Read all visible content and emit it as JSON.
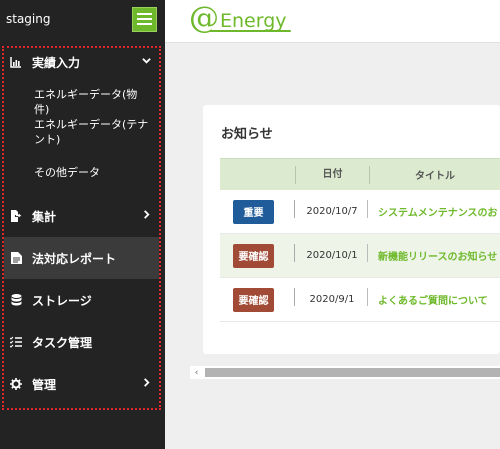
{
  "sidebar": {
    "env_label": "staging",
    "menu": {
      "jisseki": {
        "label": "実績入力",
        "icon": "bar-chart-icon",
        "chevron": "chevron-down-icon"
      },
      "sub_items": [
        {
          "label": "エネルギーデータ(物件)"
        },
        {
          "label": "エネルギーデータ(テナント)"
        },
        {
          "label": "その他データ"
        }
      ],
      "shukei": {
        "label": "集計",
        "icon": "file-export-icon",
        "chevron": "chevron-right-icon"
      },
      "houtaiou": {
        "label": "法対応レポート",
        "icon": "file-text-icon"
      },
      "storage": {
        "label": "ストレージ",
        "icon": "database-icon"
      },
      "task": {
        "label": "タスク管理",
        "icon": "list-check-icon"
      },
      "kanri": {
        "label": "管理",
        "icon": "gear-icon",
        "chevron": "chevron-right-icon"
      }
    }
  },
  "header": {
    "logo_at": "@",
    "logo_name": "Energy"
  },
  "notices": {
    "title": "お知らせ",
    "columns": {
      "date": "日付",
      "title": "タイトル"
    },
    "rows": [
      {
        "badge": "重要",
        "date": "2020/10/7",
        "title": "システムメンテナンスのお"
      },
      {
        "badge": "要確認",
        "date": "2020/10/1",
        "title": "新機能リリースのお知らせ"
      },
      {
        "badge": "要確認",
        "date": "2020/9/1",
        "title": "よくあるご質問について"
      }
    ]
  },
  "scrollbar": {
    "left_arrow": "‹"
  },
  "colors": {
    "brand_green": "#6eb92b",
    "badge_important": "#1f5c99",
    "badge_check": "#a14b37",
    "sidebar_bg": "#232323",
    "highlight_border": "#e0262b"
  }
}
